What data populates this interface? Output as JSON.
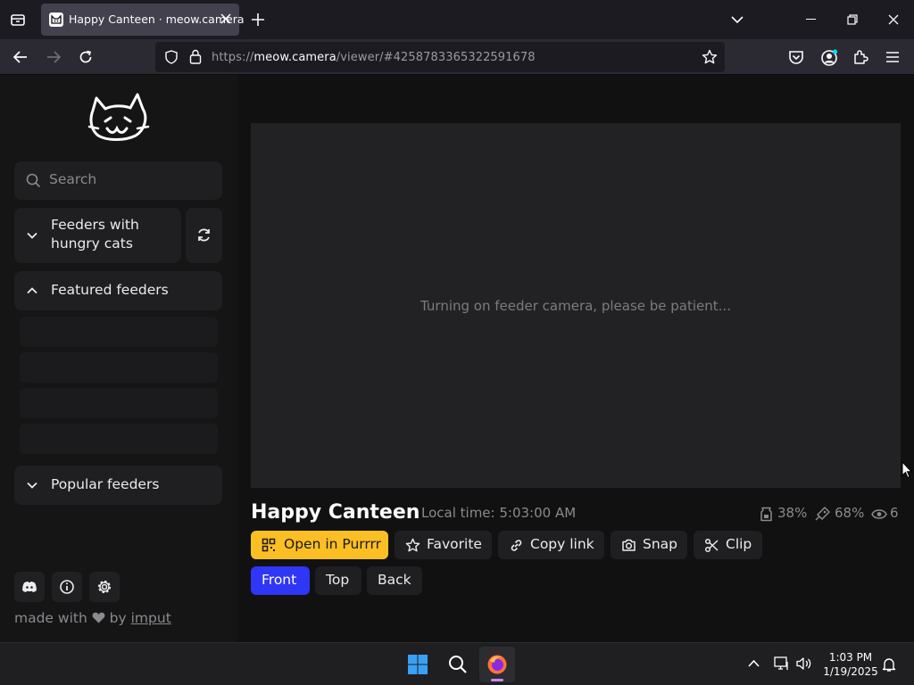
{
  "browser": {
    "tab_title": "Happy Canteen · meow.camera",
    "url_prefix": "https://",
    "url_host": "meow.camera",
    "url_path": "/viewer/#4258783365322591678"
  },
  "sidebar": {
    "search_placeholder": "Search",
    "hungry_section_label": "Feeders with hungry cats",
    "featured_section_label": "Featured feeders",
    "popular_section_label": "Popular feeders",
    "footer": {
      "made_with": "made with",
      "by": "by",
      "author_link": "imput"
    }
  },
  "viewer": {
    "status_message": "Turning on feeder camera, please be patient...",
    "feeder_name": "Happy Canteen",
    "local_time": "Local time: 5:03:00 AM",
    "stats": {
      "storage": "38%",
      "food": "68%",
      "viewers": "6"
    },
    "actions": {
      "open_app": "Open in Purrrr",
      "favorite": "Favorite",
      "copy_link": "Copy link",
      "snap": "Snap",
      "clip": "Clip"
    },
    "camera_views": [
      "Front",
      "Top",
      "Back"
    ],
    "selected_view": "Front"
  },
  "taskbar": {
    "time": "1:03 PM",
    "date": "1/19/2025"
  },
  "colors": {
    "accent_yellow": "#fbbf24",
    "accent_blue": "#2f36f5",
    "page_bg": "#111112",
    "panel_bg": "#1f1f21"
  }
}
